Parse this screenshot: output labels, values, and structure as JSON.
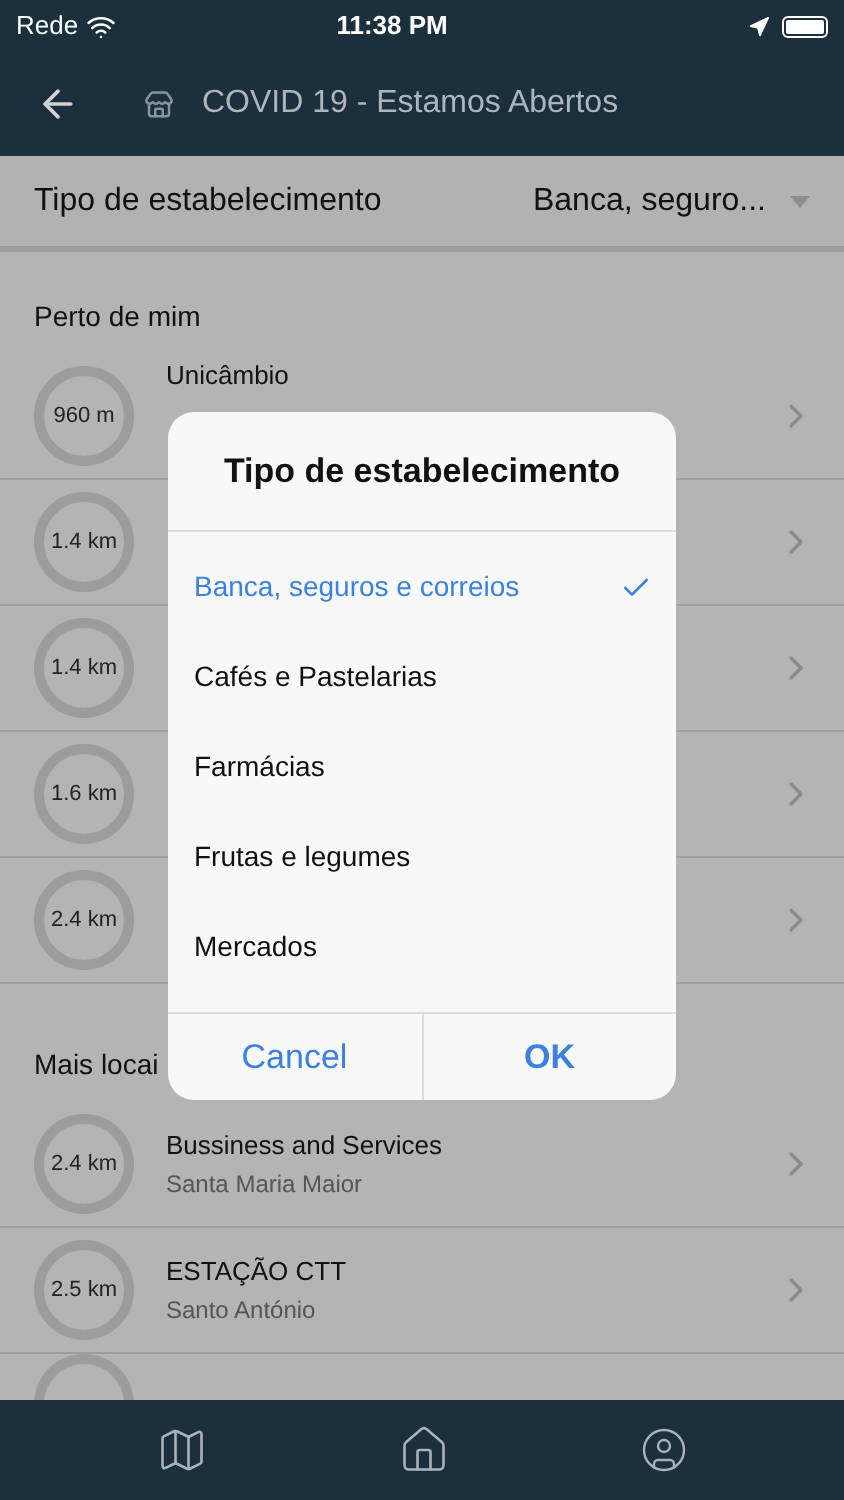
{
  "status_bar": {
    "carrier": "Rede",
    "time": "11:38 PM"
  },
  "header": {
    "title": "COVID 19 - Estamos Abertos"
  },
  "filter": {
    "label": "Tipo de estabelecimento",
    "value": "Banca, seguro..."
  },
  "nearby": {
    "title": "Perto de mim",
    "rows": [
      {
        "distance": "960 m",
        "name": "Unicâmbio"
      },
      {
        "distance": "1.4 km"
      },
      {
        "distance": "1.4 km"
      },
      {
        "distance": "1.6 km"
      },
      {
        "distance": "2.4 km"
      }
    ]
  },
  "more": {
    "title": "Mais locai",
    "rows": [
      {
        "distance": "2.4 km",
        "name": "Bussiness and Services",
        "place": "Santa Maria Maior"
      },
      {
        "distance": "2.5 km",
        "name": "ESTAÇÃO CTT",
        "place": "Santo António"
      }
    ]
  },
  "dialog": {
    "title": "Tipo de estabelecimento",
    "options": [
      {
        "label": "Banca, seguros e correios",
        "selected": true
      },
      {
        "label": "Cafés e Pastelarias",
        "selected": false
      },
      {
        "label": "Farmácias",
        "selected": false
      },
      {
        "label": "Frutas e legumes",
        "selected": false
      },
      {
        "label": "Mercados",
        "selected": false
      }
    ],
    "cancel": "Cancel",
    "ok": "OK"
  }
}
